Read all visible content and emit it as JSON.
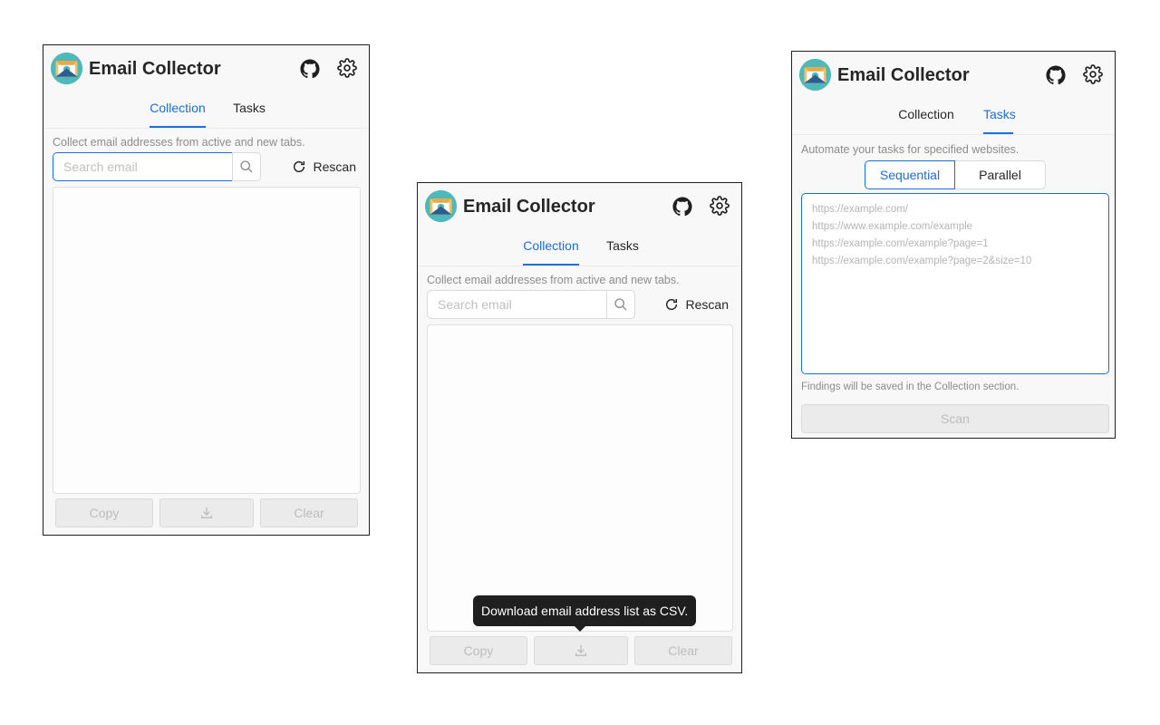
{
  "app": {
    "title": "Email Collector",
    "icons": [
      "envelope-logo-icon",
      "github-icon",
      "gear-icon",
      "search-icon",
      "refresh-icon",
      "download-icon"
    ],
    "colors": {
      "accent": "#1a6fe0",
      "logo_circle": "#4fb8b8",
      "logo_envelope": "#f2c26b"
    }
  },
  "tabs": {
    "collection": "Collection",
    "tasks": "Tasks"
  },
  "collection": {
    "description": "Collect email addresses from active and new tabs.",
    "search_placeholder": "Search email",
    "rescan_label": "Rescan",
    "copy_label": "Copy",
    "clear_label": "Clear"
  },
  "tooltip": {
    "download": "Download email address list as CSV."
  },
  "tasks": {
    "description": "Automate your tasks for specified websites.",
    "mode_sequential": "Sequential",
    "mode_parallel": "Parallel",
    "selected_mode": "Sequential",
    "url_placeholder_lines": [
      "https://example.com/",
      "https://www.example.com/example",
      "https://example.com/example?page=1",
      "https://example.com/example?page=2&size=10"
    ],
    "footer_note": "Findings will be saved in the Collection section.",
    "scan_label": "Scan"
  }
}
